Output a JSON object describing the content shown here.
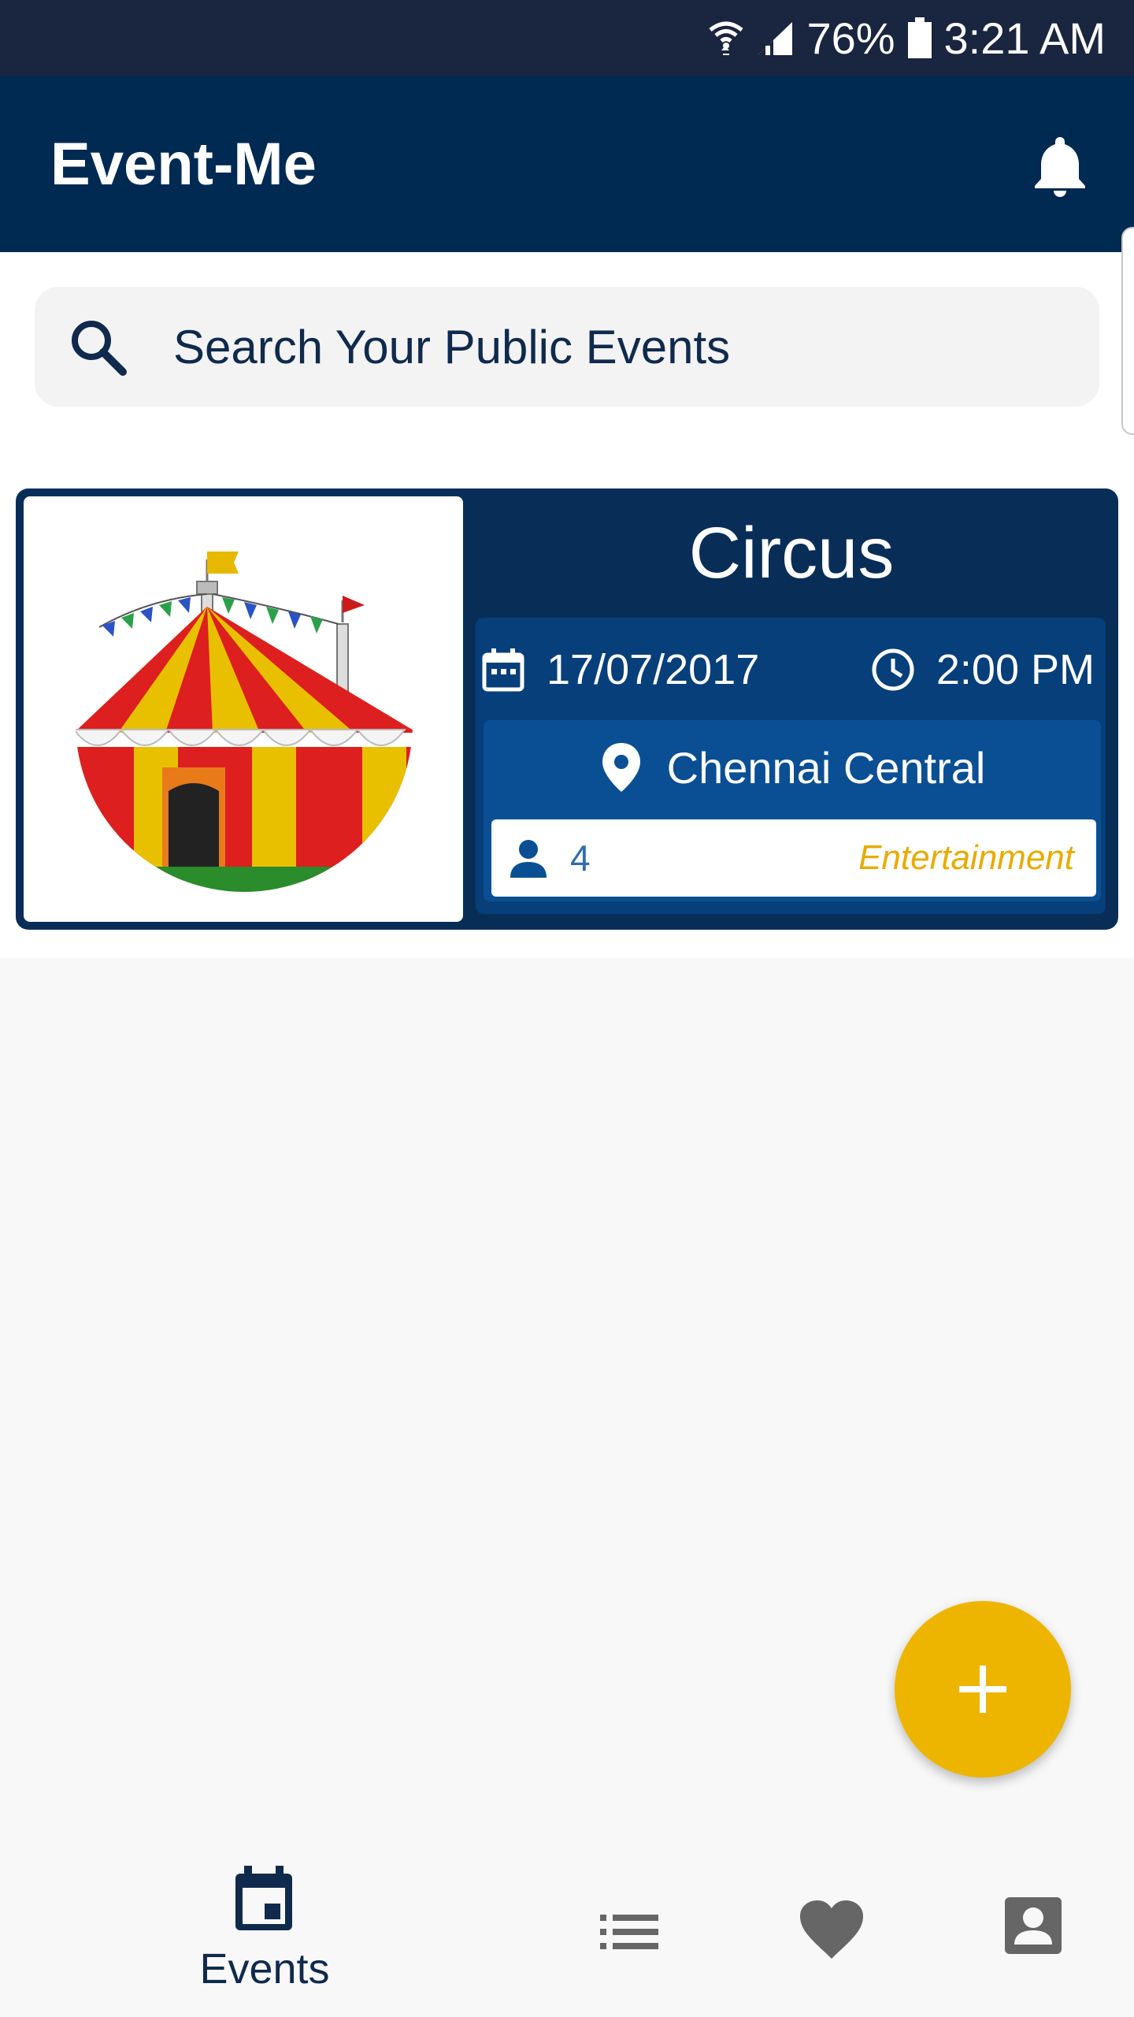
{
  "status_bar": {
    "battery": "76%",
    "time": "3:21 AM"
  },
  "app_bar": {
    "title": "Event-Me",
    "notification_icon": "bell-icon"
  },
  "search": {
    "placeholder": "Search Your Public Events",
    "icon": "search-icon"
  },
  "events": [
    {
      "title": "Circus",
      "image": "circus-tent",
      "date": "17/07/2017",
      "time": "2:00 PM",
      "location": "Chennai Central",
      "attendees": "4",
      "category": "Entertainment"
    }
  ],
  "fab": {
    "icon": "plus-icon"
  },
  "bottom_nav": {
    "items": [
      {
        "label": "Events",
        "icon": "calendar-icon",
        "active": true
      },
      {
        "label": "",
        "icon": "list-icon",
        "active": false
      },
      {
        "label": "",
        "icon": "heart-icon",
        "active": false
      },
      {
        "label": "",
        "icon": "profile-icon",
        "active": false
      }
    ]
  },
  "colors": {
    "primary": "#002a52",
    "card": "#082e58",
    "details": "#073f7a",
    "location": "#0a4f94",
    "accent": "#edb500",
    "category": "#e8ab00"
  }
}
